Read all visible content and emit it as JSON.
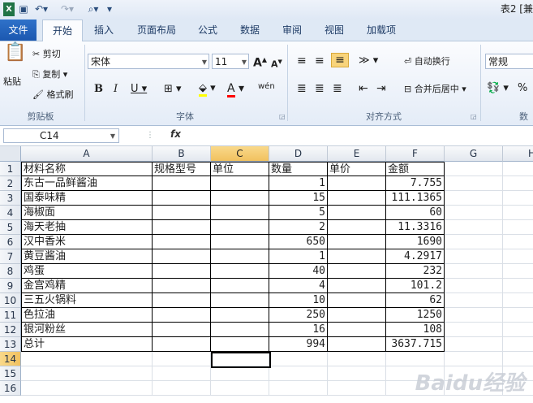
{
  "title": "表2 [兼",
  "ribbon_tabs": [
    "文件",
    "开始",
    "插入",
    "页面布局",
    "公式",
    "数据",
    "审阅",
    "视图",
    "加载项"
  ],
  "clipboard": {
    "paste": "粘贴",
    "cut": "剪切",
    "copy": "复制",
    "format_painter": "格式刷",
    "group": "剪贴板"
  },
  "font": {
    "name": "宋体",
    "size": "11",
    "bold": "B",
    "italic": "I",
    "underline": "U",
    "group": "字体",
    "grow": "A",
    "shrink": "A",
    "phonetic": "wén"
  },
  "alignment": {
    "wrap": "自动换行",
    "merge": "合并后居中",
    "group": "对齐方式"
  },
  "number": {
    "format": "常规",
    "percent": "%",
    "group": "数"
  },
  "name_box": "C14",
  "fx": "fx",
  "columns": [
    "A",
    "B",
    "C",
    "D",
    "E",
    "F",
    "G",
    "H"
  ],
  "rows": [
    "1",
    "2",
    "3",
    "4",
    "5",
    "6",
    "7",
    "8",
    "9",
    "10",
    "11",
    "12",
    "13",
    "14",
    "15",
    "16"
  ],
  "table": [
    [
      "材料名称",
      "规格型号",
      "单位",
      "数量",
      "单价",
      "金额"
    ],
    [
      "东古一品鲜酱油",
      "",
      "",
      "1",
      "",
      "7.755"
    ],
    [
      "国泰味精",
      "",
      "",
      "15",
      "",
      "111.1365"
    ],
    [
      "海椒面",
      "",
      "",
      "5",
      "",
      "60"
    ],
    [
      "海天老抽",
      "",
      "",
      "2",
      "",
      "11.3316"
    ],
    [
      "汉中香米",
      "",
      "",
      "650",
      "",
      "1690"
    ],
    [
      "黄豆酱油",
      "",
      "",
      "1",
      "",
      "4.2917"
    ],
    [
      "鸡蛋",
      "",
      "",
      "40",
      "",
      "232"
    ],
    [
      "金宫鸡精",
      "",
      "",
      "4",
      "",
      "101.2"
    ],
    [
      "三五火锅料",
      "",
      "",
      "10",
      "",
      "62"
    ],
    [
      "色拉油",
      "",
      "",
      "250",
      "",
      "1250"
    ],
    [
      "银河粉丝",
      "",
      "",
      "16",
      "",
      "108"
    ],
    [
      "总计",
      "",
      "",
      "994",
      "",
      "3637.715"
    ]
  ],
  "watermark": "Baidu经验",
  "colors": {
    "file_tab": "#1b58b0",
    "selected_header": "#f1c15f"
  }
}
